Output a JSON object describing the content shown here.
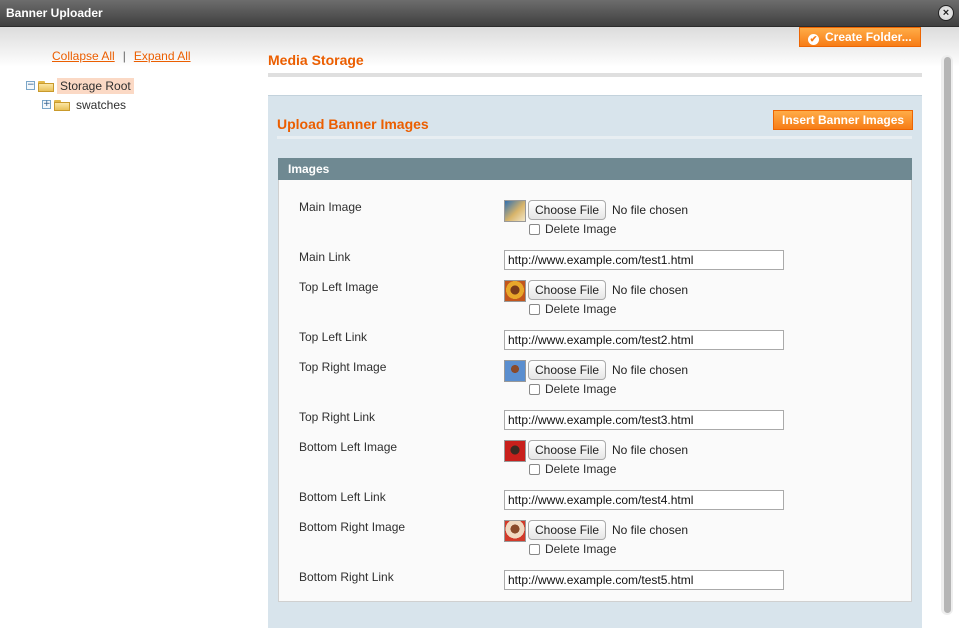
{
  "window": {
    "title": "Banner Uploader"
  },
  "sidebar": {
    "collapse_all": "Collapse All",
    "separator": "|",
    "expand_all": "Expand All",
    "tree": [
      {
        "label": "Storage Root",
        "toggle": "−",
        "selected": true
      },
      {
        "label": "swatches",
        "toggle": "+",
        "selected": false
      }
    ]
  },
  "header": {
    "title": "Media Storage",
    "create_folder": "Create Folder..."
  },
  "upload": {
    "title": "Upload Banner Images",
    "insert_button": "Insert Banner Images",
    "fieldset_title": "Images",
    "choose_file": "Choose File",
    "no_file": "No file chosen",
    "delete_image": "Delete Image",
    "fields": {
      "main_image": "Main Image",
      "main_link": "Main Link",
      "main_link_value": "http://www.example.com/test1.html",
      "top_left_image": "Top Left Image",
      "top_left_link": "Top Left Link",
      "top_left_link_value": "http://www.example.com/test2.html",
      "top_right_image": "Top Right Image",
      "top_right_link": "Top Right Link",
      "top_right_link_value": "http://www.example.com/test3.html",
      "bottom_left_image": "Bottom Left Image",
      "bottom_left_link": "Bottom Left Link",
      "bottom_left_link_value": "http://www.example.com/test4.html",
      "bottom_right_image": "Bottom Right Image",
      "bottom_right_link": "Bottom Right Link",
      "bottom_right_link_value": "http://www.example.com/test5.html"
    }
  },
  "icons": {
    "close": "close-icon",
    "folder": "folder-icon",
    "check": "checkmark-circle-icon"
  },
  "colors": {
    "accent": "#eb5e00",
    "button": "#f77c16",
    "panel": "#d8e4ec",
    "fieldset_header": "#6f8992"
  }
}
